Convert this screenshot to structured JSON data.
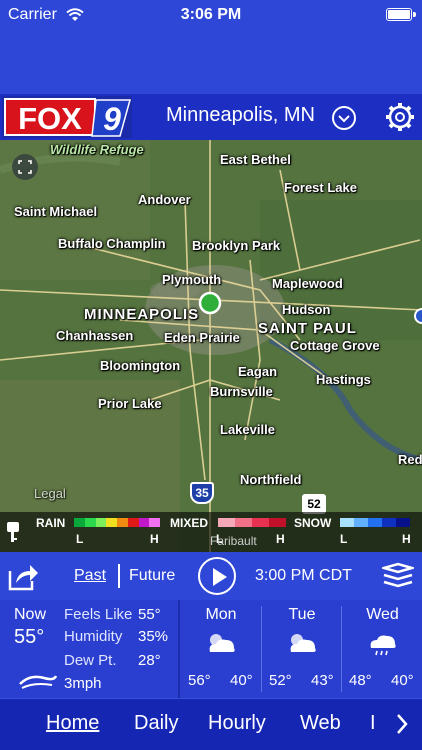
{
  "status_bar": {
    "carrier": "Carrier",
    "time": "3:06 PM"
  },
  "header": {
    "logo_text": "FOX",
    "logo_number": "9",
    "location": "Minneapolis, MN"
  },
  "map": {
    "labels": {
      "wildlife_refuge": "Wildlife Refuge",
      "east_bethel": "East Bethel",
      "forest_lake": "Forest Lake",
      "andover": "Andover",
      "saint_michael": "Saint Michael",
      "buffalo_champlin": "Buffalo Champlin",
      "brooklyn_park": "Brooklyn Park",
      "plymouth": "Plymouth",
      "maplewood": "Maplewood",
      "minneapolis": "MINNEAPOLIS",
      "hudson": "Hudson",
      "saint_paul": "SAINT PAUL",
      "chanhassen": "Chanhassen",
      "eden_prairie": "Eden Prairie",
      "cottage_grove": "Cottage Grove",
      "bloomington": "Bloomington",
      "eagan": "Eagan",
      "hastings": "Hastings",
      "burnsville": "Burnsville",
      "prior_lake": "Prior Lake",
      "lakeville": "Lakeville",
      "northfield": "Northfield",
      "red": "Red",
      "faribault": "Faribault",
      "legal": "Legal",
      "i35": "35",
      "us52": "52"
    },
    "legend": {
      "rain": "RAIN",
      "mixed": "MIXED",
      "snow": "SNOW",
      "rain_l": "L",
      "rain_h": "H",
      "mixed_l": "L",
      "mixed_h": "H",
      "snow_l": "L",
      "snow_h": "H",
      "rain_colors": [
        "#0aa83a",
        "#2bd84c",
        "#7bee5a",
        "#f0e020",
        "#f08a10",
        "#e01818",
        "#c018c8",
        "#f070f0"
      ],
      "mixed_colors": [
        "#f4a8b8",
        "#f07088",
        "#e83050",
        "#c0102a"
      ],
      "snow_colors": [
        "#a8e0ff",
        "#60b0ff",
        "#2070f0",
        "#1030c0",
        "#08108a"
      ]
    }
  },
  "controls": {
    "past": "Past",
    "future": "Future",
    "timestamp": "3:00 PM CDT"
  },
  "conditions": {
    "now_label": "Now",
    "now_temp": "55°",
    "feels_like_label": "Feels Like",
    "feels_like": "55°",
    "humidity_label": "Humidity",
    "humidity": "35%",
    "dewpt_label": "Dew Pt.",
    "dewpt": "28°",
    "wind": "3mph"
  },
  "forecast": [
    {
      "day": "Mon",
      "high": "56°",
      "low": "40°",
      "icon": "partly-cloudy-icon"
    },
    {
      "day": "Tue",
      "high": "52°",
      "low": "43°",
      "icon": "partly-cloudy-icon"
    },
    {
      "day": "Wed",
      "high": "48°",
      "low": "40°",
      "icon": "rain-cloud-icon"
    }
  ],
  "nav": {
    "home": "Home",
    "daily": "Daily",
    "hourly": "Hourly",
    "web": "Web",
    "more": "I"
  }
}
